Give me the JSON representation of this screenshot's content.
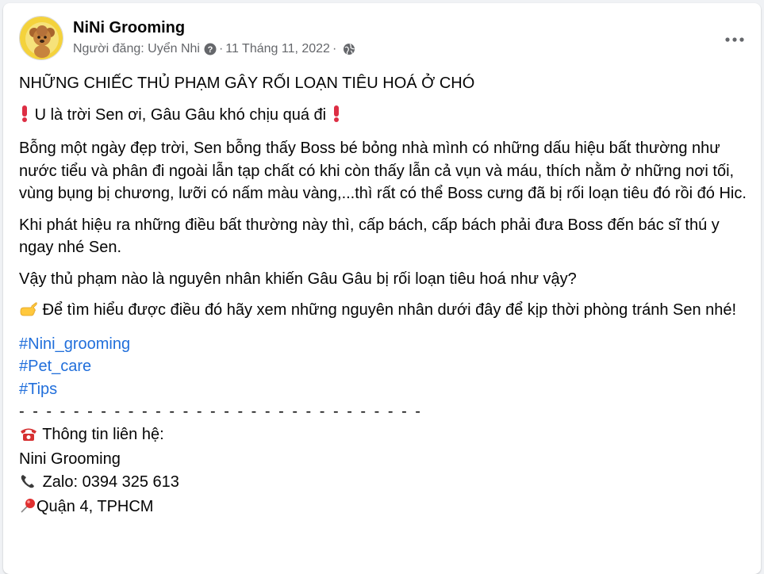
{
  "post": {
    "page_name": "NiNi Grooming",
    "author_prefix": "Người đăng: Uyển Nhi",
    "date": "11 Tháng 11, 2022",
    "separator": "·"
  },
  "content": {
    "title": "NHỮNG CHIẾC THỦ PHẠM GÂY RỐI LOẠN TIÊU HOÁ Ở CHÓ",
    "line_alert": "U là trời Sen ơi, Gâu Gâu khó chịu quá đi",
    "para1": "Bỗng một ngày đẹp trời, Sen bỗng thấy Boss bé bỏng nhà mình có những dấu hiệu bất thường như nước tiểu và phân đi ngoài lẫn tạp chất có khi còn thấy lẫn cả vụn và máu, thích nằm ở những nơi tối, vùng bụng bị chương, lưỡi có nấm màu vàng,...thì rất có thể Boss cưng đã bị rối loạn tiêu đó rồi đó Hic.",
    "para2": "Khi phát hiệu ra những điều bất thường này thì, cấp bách, cấp bách phải đưa Boss đến bác sĩ thú y ngay nhé Sen.",
    "para3": "Vậy thủ phạm nào là nguyên nhân khiến Gâu Gâu bị rối loạn tiêu hoá như vậy?",
    "para4": "Để tìm hiểu được điều đó hãy xem những nguyên nhân dưới đây để kịp thời phòng tránh Sen nhé!",
    "hashtags": [
      "#Nini_grooming",
      "#Pet_care",
      "#Tips"
    ],
    "dashes": "- - - - - - - - - - - - - - - - - - - - - - - - - - - - - -",
    "contact_heading": "Thông tin liên hệ:",
    "contact_name": "Nini Grooming",
    "contact_phone": "Zalo: 0394 325 613",
    "contact_address": "Quận 4, TPHCM"
  },
  "icons": {
    "alert": "exclamation-icon",
    "pointing": "pointing-hand-icon",
    "telephone": "telephone-icon",
    "handset": "phone-handset-icon",
    "pin": "pushpin-icon",
    "privacy": "globe-icon",
    "more": "more-options-icon"
  },
  "colors": {
    "link": "#216fdb",
    "secondary_text": "#65676b",
    "alert_red": "#dd2e44"
  }
}
